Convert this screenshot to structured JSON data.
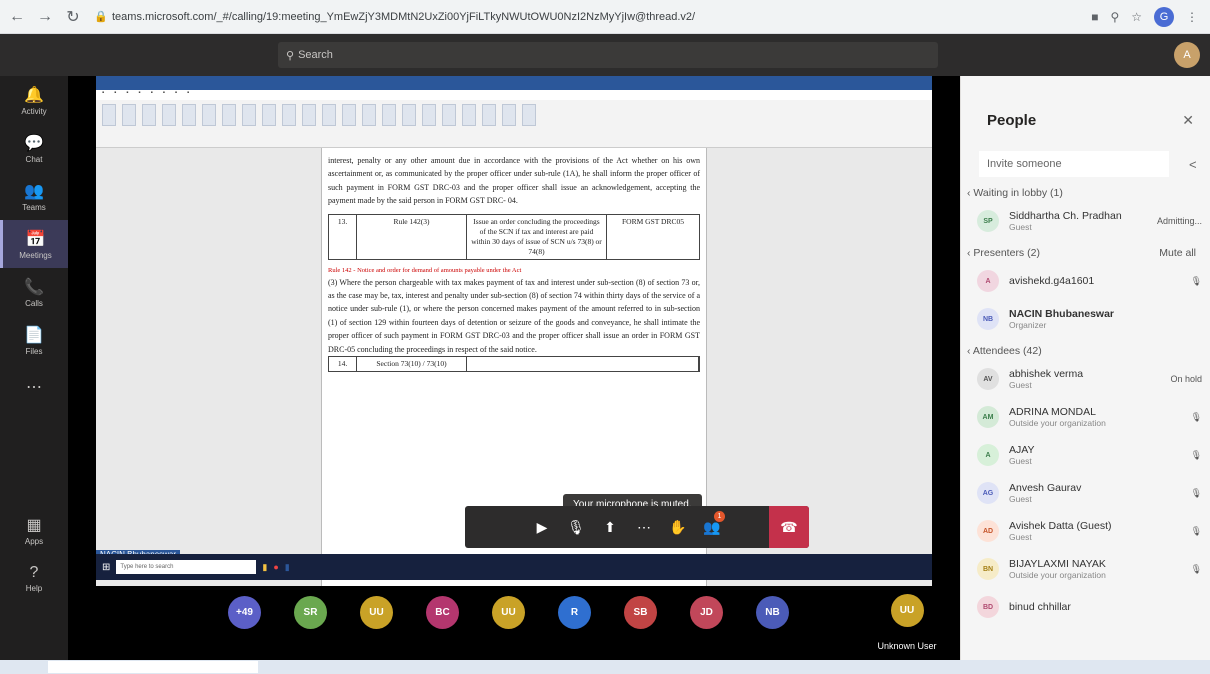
{
  "browser": {
    "url": "teams.microsoft.com/_#/calling/19:meeting_YmEwZjY3MDMtN2UxZi00YjFiLTkyNWUtOWU0NzI2NzMyYjIw@thread.v2/",
    "back_icon": "back-arrow-icon",
    "forward_icon": "forward-arrow-icon",
    "reload_icon": "reload-icon",
    "profile_initial": "G"
  },
  "teams": {
    "search_placeholder": "Search",
    "me_initial": "A",
    "rail": [
      {
        "name": "activity",
        "label": "Activity",
        "icon": "🔔"
      },
      {
        "name": "chat",
        "label": "Chat",
        "icon": "💬"
      },
      {
        "name": "teams",
        "label": "Teams",
        "icon": "👥"
      },
      {
        "name": "meetings",
        "label": "Meetings",
        "icon": "📅",
        "active": true
      },
      {
        "name": "calls",
        "label": "Calls",
        "icon": "📞"
      },
      {
        "name": "files",
        "label": "Files",
        "icon": "📄"
      },
      {
        "name": "more",
        "label": "",
        "icon": "⋯"
      }
    ],
    "rail_bottom": [
      {
        "name": "apps",
        "label": "Apps",
        "icon": "▦"
      },
      {
        "name": "help",
        "label": "Help",
        "icon": "?"
      }
    ]
  },
  "document": {
    "para1": "interest, penalty or any other amount due in accordance with the provisions of the Act whether on his own ascertainment or, as communicated by the proper officer under sub-rule (1A), he shall inform the proper officer of such payment in FORM GST DRC-03 and the proper officer shall issue an acknowledgement, accepting the payment made by the said person in FORM GST DRC- 04.",
    "row13": [
      "13.",
      "Rule 142(3)",
      "Issue an order concluding the proceedings of the SCN if tax and interest are paid within 30 days of issue of SCN u/s 73(8) or 74(8)",
      "FORM GST DRC05"
    ],
    "rule_red": "Rule 142 - Notice and order for demand of amounts payable under the Act",
    "para2": "(3) Where the person chargeable with tax makes payment of tax and interest under sub-section (8) of section 73 or, as the case may be, tax, interest and penalty under sub-section (8) of section 74 within thirty days of the service of a notice under sub-rule (1), or where the person concerned makes payment of the amount referred to in sub-section (1) of section 129 within fourteen days of detention or seizure of the goods and conveyance, he shall intimate the proper officer of such payment in FORM GST DRC-03 and the proper officer shall issue an order in FORM GST DRC-05 concluding the proceedings in respect of the said notice.",
    "row14": [
      "14.",
      "Section 73(10) / 73(10)",
      ""
    ]
  },
  "presenter_tag": "NACIN Bhubaneswar",
  "remote_search": "Type here to search",
  "toast": "Your microphone is muted.",
  "controls": {
    "participants_badge": "1"
  },
  "gallery": [
    {
      "initials": "+49",
      "color": "#5b5fc7"
    },
    {
      "initials": "SR",
      "color": "#6aa84f"
    },
    {
      "initials": "UU",
      "color": "#c9a227"
    },
    {
      "initials": "BC",
      "color": "#b4366e"
    },
    {
      "initials": "UU",
      "color": "#c9a227"
    },
    {
      "initials": "R",
      "color": "#2f6fd0"
    },
    {
      "initials": "SB",
      "color": "#c14444"
    },
    {
      "initials": "JD",
      "color": "#c1475a"
    },
    {
      "initials": "NB",
      "color": "#4b5bb8"
    }
  ],
  "unknown_user": {
    "initials": "UU",
    "label": "Unknown User"
  },
  "people": {
    "title": "People",
    "invite_placeholder": "Invite someone",
    "lobby_header": "Waiting in lobby (1)",
    "lobby": [
      {
        "initials": "SP",
        "name": "Siddhartha Ch. Pradhan",
        "role": "Guest",
        "right": "Admitting...",
        "bg": "#d7ecdd",
        "fg": "#3b7d4b"
      }
    ],
    "presenters_header": "Presenters (2)",
    "presenters_right": "Mute all",
    "presenters": [
      {
        "initials": "A",
        "name": "avishekd.g4a1601",
        "role": "",
        "right": "mic-off",
        "bg": "#f1d6e0",
        "fg": "#b04a70"
      },
      {
        "initials": "NB",
        "name": "NACIN Bhubaneswar",
        "role": "Organizer",
        "right": "",
        "bg": "#dfe3f6",
        "fg": "#4b5bb8",
        "bold": true
      }
    ],
    "attendees_header": "Attendees (42)",
    "attendees": [
      {
        "initials": "AV",
        "name": "abhishek verma",
        "role": "Guest",
        "right": "On hold",
        "bg": "#e0e0e0",
        "fg": "#555"
      },
      {
        "initials": "AM",
        "name": "ADRINA MONDAL",
        "role": "Outside your organization",
        "right": "mic-off",
        "bg": "#d4ead7",
        "fg": "#3b7d4b"
      },
      {
        "initials": "A",
        "name": "AJAY",
        "role": "Guest",
        "right": "mic-off",
        "bg": "#d7f0d9",
        "fg": "#3b7d4b"
      },
      {
        "initials": "AG",
        "name": "Anvesh Gaurav",
        "role": "Guest",
        "right": "mic-off",
        "bg": "#dfe3f6",
        "fg": "#4b5bb8"
      },
      {
        "initials": "AD",
        "name": "Avishek Datta (Guest)",
        "role": "Guest",
        "right": "mic-off",
        "bg": "#fde2d7",
        "fg": "#c5542a"
      },
      {
        "initials": "BN",
        "name": "BIJAYLAXMI NAYAK",
        "role": "Outside your organization",
        "right": "mic-off",
        "bg": "#f6ecc8",
        "fg": "#a47f14"
      },
      {
        "initials": "BD",
        "name": "binud chhillar",
        "role": "",
        "right": "",
        "bg": "#f3d6dc",
        "fg": "#b04a70"
      }
    ]
  }
}
